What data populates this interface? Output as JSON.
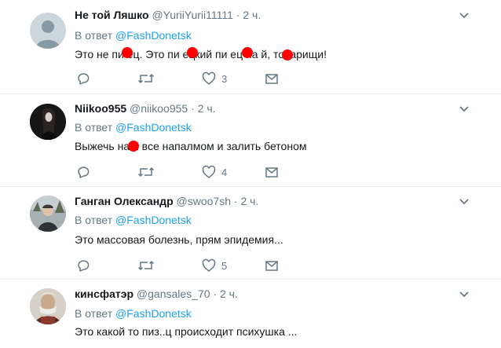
{
  "tweets": [
    {
      "name": "Не той Ляшко",
      "handle": "@YuriiYurii11111",
      "dot": "·",
      "time": "2 ч.",
      "reply_prefix": "В ответ",
      "reply_to": "@FashDonetsk",
      "text": "Это не пи   ец. Это пи   ецкий пи   ец на   й, товарищи!",
      "likes": "3"
    },
    {
      "name": "Niikoo955",
      "handle": "@niikoo955",
      "dot": "·",
      "time": "2 ч.",
      "reply_prefix": "В ответ",
      "reply_to": "@FashDonetsk",
      "text": "Выжечь на   й все напалмом и залить бетоном",
      "likes": "4"
    },
    {
      "name": "Ганган Олександр",
      "handle": "@swoo7sh",
      "dot": "·",
      "time": "2 ч.",
      "reply_prefix": "В ответ",
      "reply_to": "@FashDonetsk",
      "text": "Это массовая болезнь, прям эпидемия...",
      "likes": "5"
    },
    {
      "name": "кинсфатэр",
      "handle": "@gansales_70",
      "dot": "·",
      "time": "2 ч.",
      "reply_prefix": "В ответ",
      "reply_to": "@FashDonetsk",
      "text": "Это какой то пиз..ц происходит психушка ..."
    }
  ],
  "colors": {
    "accent": "#1da1f2",
    "muted": "#657786",
    "border": "#e6ecf0",
    "redaction": "#ff0000"
  }
}
